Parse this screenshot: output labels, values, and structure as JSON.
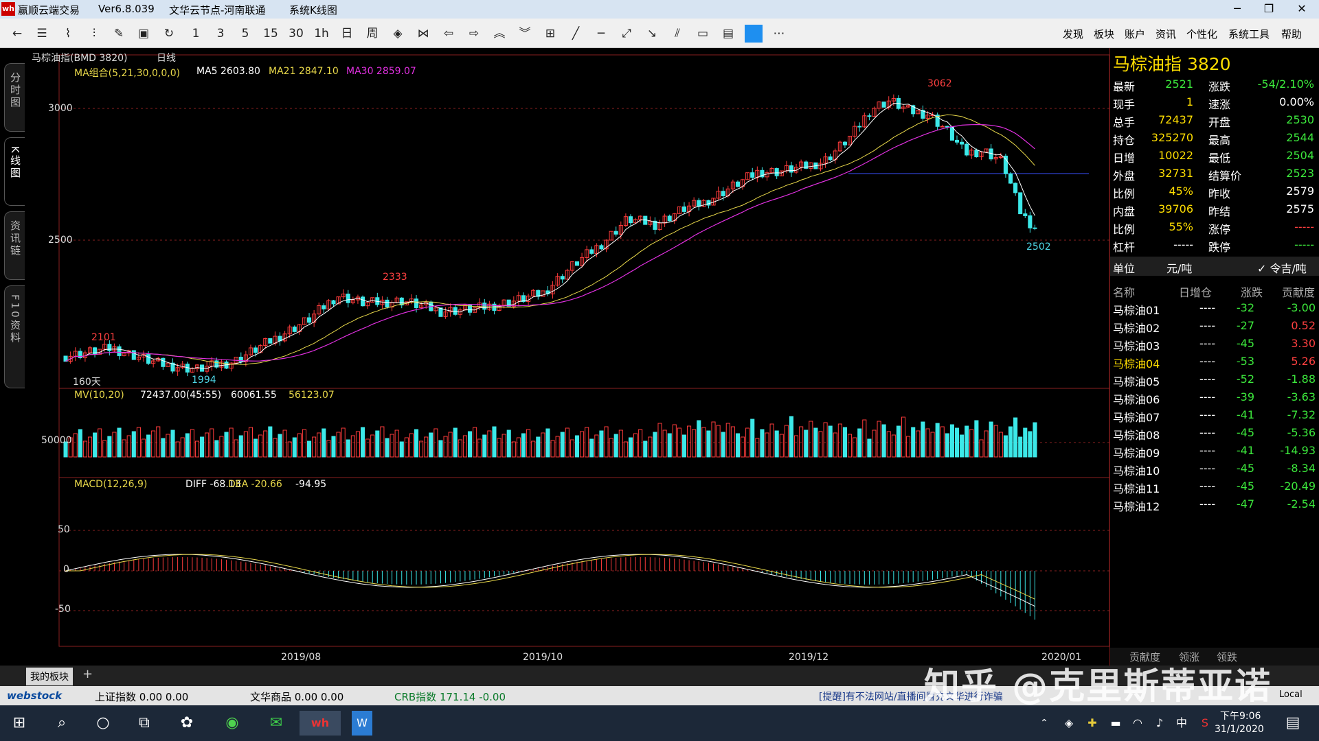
{
  "window": {
    "title_app": "赢顺云端交易",
    "version": "Ver6.8.039",
    "node": "文华云节点-河南联通",
    "view": "系统K线图",
    "minimize": "─",
    "restore": "❐",
    "close": "✕"
  },
  "toolbar": {
    "icons": [
      "back-icon",
      "list-icon",
      "line-chart-icon",
      "candle-icon",
      "draw-icon",
      "save-icon",
      "refresh-icon"
    ],
    "periods": [
      "1",
      "3",
      "5",
      "15",
      "30",
      "1h",
      "日",
      "周"
    ],
    "menu": [
      "发现",
      "板块",
      "账户",
      "资讯",
      "个性化",
      "系统工具",
      "帮助"
    ]
  },
  "sidebar": {
    "tabs": [
      "分时图",
      "K线图",
      "资讯链",
      "F10资料"
    ]
  },
  "chart": {
    "instrument": "马棕油指(BMD 3820)",
    "period": "日线",
    "ma_label": "MA组合(5,21,30,0,0,0)",
    "ma5": "MA5 2603.80",
    "ma21": "MA21 2847.10",
    "ma30": "MA30 2859.07",
    "price_ticks": [
      "3000",
      "2500"
    ],
    "high_label": "3062",
    "low_label": "2502",
    "left_high": "2101",
    "left_low": "1994",
    "mid_high": "2333",
    "days": "160天",
    "vol_label": "MV(10,20)",
    "vol_values": "72437.00(45:55)",
    "vol_ma10": "60061.55",
    "vol_ma20": "56123.07",
    "vol_tick": "50000",
    "macd_label": "MACD(12,26,9)",
    "macd_diff": "DIFF -68.13",
    "macd_dea": "DEA -20.66",
    "macd_val": "-94.95",
    "macd_ticks": [
      "50",
      "0",
      "-50"
    ],
    "date_ticks": [
      "2019/08",
      "2019/10",
      "2019/12",
      "2020/01"
    ]
  },
  "quote": {
    "title": "马棕油指 3820",
    "rows": [
      {
        "l1": "最新",
        "v1": "2521",
        "c1": "g",
        "l2": "涨跌",
        "v2": "-54/2.10%",
        "c2": "g"
      },
      {
        "l1": "现手",
        "v1": "1",
        "c1": "y",
        "l2": "速涨",
        "v2": "0.00%",
        "c2": "w"
      },
      {
        "l1": "总手",
        "v1": "72437",
        "c1": "y",
        "l2": "开盘",
        "v2": "2530",
        "c2": "g"
      },
      {
        "l1": "持仓",
        "v1": "325270",
        "c1": "y",
        "l2": "最高",
        "v2": "2544",
        "c2": "g"
      },
      {
        "l1": "日增",
        "v1": "10022",
        "c1": "y",
        "l2": "最低",
        "v2": "2504",
        "c2": "g"
      },
      {
        "l1": "外盘",
        "v1": "32731",
        "c1": "y",
        "l2": "结算价",
        "v2": "2523",
        "c2": "g"
      },
      {
        "l1": "比例",
        "v1": "45%",
        "c1": "y",
        "l2": "昨收",
        "v2": "2579",
        "c2": "w"
      },
      {
        "l1": "内盘",
        "v1": "39706",
        "c1": "y",
        "l2": "昨结",
        "v2": "2575",
        "c2": "w"
      },
      {
        "l1": "比例",
        "v1": "55%",
        "c1": "y",
        "l2": "涨停",
        "v2": "-----",
        "c2": "r"
      },
      {
        "l1": "杠杆",
        "v1": "-----",
        "c1": "w",
        "l2": "跌停",
        "v2": "-----",
        "c2": "g"
      }
    ],
    "unit_label": "单位",
    "unit": "元/吨",
    "unit_check": "✓ 令吉/吨",
    "contrib_headers": [
      "名称",
      "日增仓",
      "涨跌",
      "贡献度"
    ],
    "contracts": [
      {
        "name": "马棕油01",
        "inc": "----",
        "chg": "-32",
        "con": "-3.00",
        "cc": "g"
      },
      {
        "name": "马棕油02",
        "inc": "----",
        "chg": "-27",
        "con": "0.52",
        "cc": "r"
      },
      {
        "name": "马棕油03",
        "inc": "----",
        "chg": "-45",
        "con": "3.30",
        "cc": "r"
      },
      {
        "name": "马棕油04",
        "inc": "----",
        "chg": "-53",
        "con": "5.26",
        "cc": "r"
      },
      {
        "name": "马棕油05",
        "inc": "----",
        "chg": "-52",
        "con": "-1.88",
        "cc": "g"
      },
      {
        "name": "马棕油06",
        "inc": "----",
        "chg": "-39",
        "con": "-3.63",
        "cc": "g"
      },
      {
        "name": "马棕油07",
        "inc": "----",
        "chg": "-41",
        "con": "-7.32",
        "cc": "g"
      },
      {
        "name": "马棕油08",
        "inc": "----",
        "chg": "-45",
        "con": "-5.36",
        "cc": "g"
      },
      {
        "name": "马棕油09",
        "inc": "----",
        "chg": "-41",
        "con": "-14.93",
        "cc": "g"
      },
      {
        "name": "马棕油10",
        "inc": "----",
        "chg": "-45",
        "con": "-8.34",
        "cc": "g"
      },
      {
        "name": "马棕油11",
        "inc": "----",
        "chg": "-45",
        "con": "-20.49",
        "cc": "g"
      },
      {
        "name": "马棕油12",
        "inc": "----",
        "chg": "-47",
        "con": "-2.54",
        "cc": "g"
      }
    ],
    "bottom_tabs": [
      "贡献度",
      "领涨",
      "领跌"
    ]
  },
  "bottom": {
    "tab": "我的板块",
    "add": "+"
  },
  "indexbar": {
    "logo": "webstock",
    "idx1": "上证指数  0.00  0.00",
    "idx2": "文华商品  0.00  0.00",
    "idx3": "CRB指数    171.14  -0.00",
    "notice": "[提醒]有不法网站/直播间冒充文华进行诈骗",
    "local": "Local"
  },
  "taskbar": {
    "time": "下午9:06",
    "date": "31/1/2020",
    "ime": "中"
  },
  "watermark": "知乎 @克里斯蒂亚诺",
  "chart_data": {
    "type": "candlestick",
    "title": "马棕油指(BMD 3820) 日线",
    "x_ticks": [
      "2019/08",
      "2019/10",
      "2019/12",
      "2020/01"
    ],
    "y_ticks": [
      3000,
      2500
    ],
    "annotations": {
      "high": 3062,
      "low": 2502,
      "left_high": 2101,
      "left_low": 1994,
      "mid_high": 2333
    },
    "ma": {
      "MA5": 2603.8,
      "MA21": 2847.1,
      "MA30": 2859.07
    },
    "macd": {
      "DIFF": -68.13,
      "DEA": -20.66,
      "MACD": -94.95
    },
    "volume": {
      "latest": 72437,
      "MA10": 60061.55,
      "MA20": 56123.07
    }
  }
}
